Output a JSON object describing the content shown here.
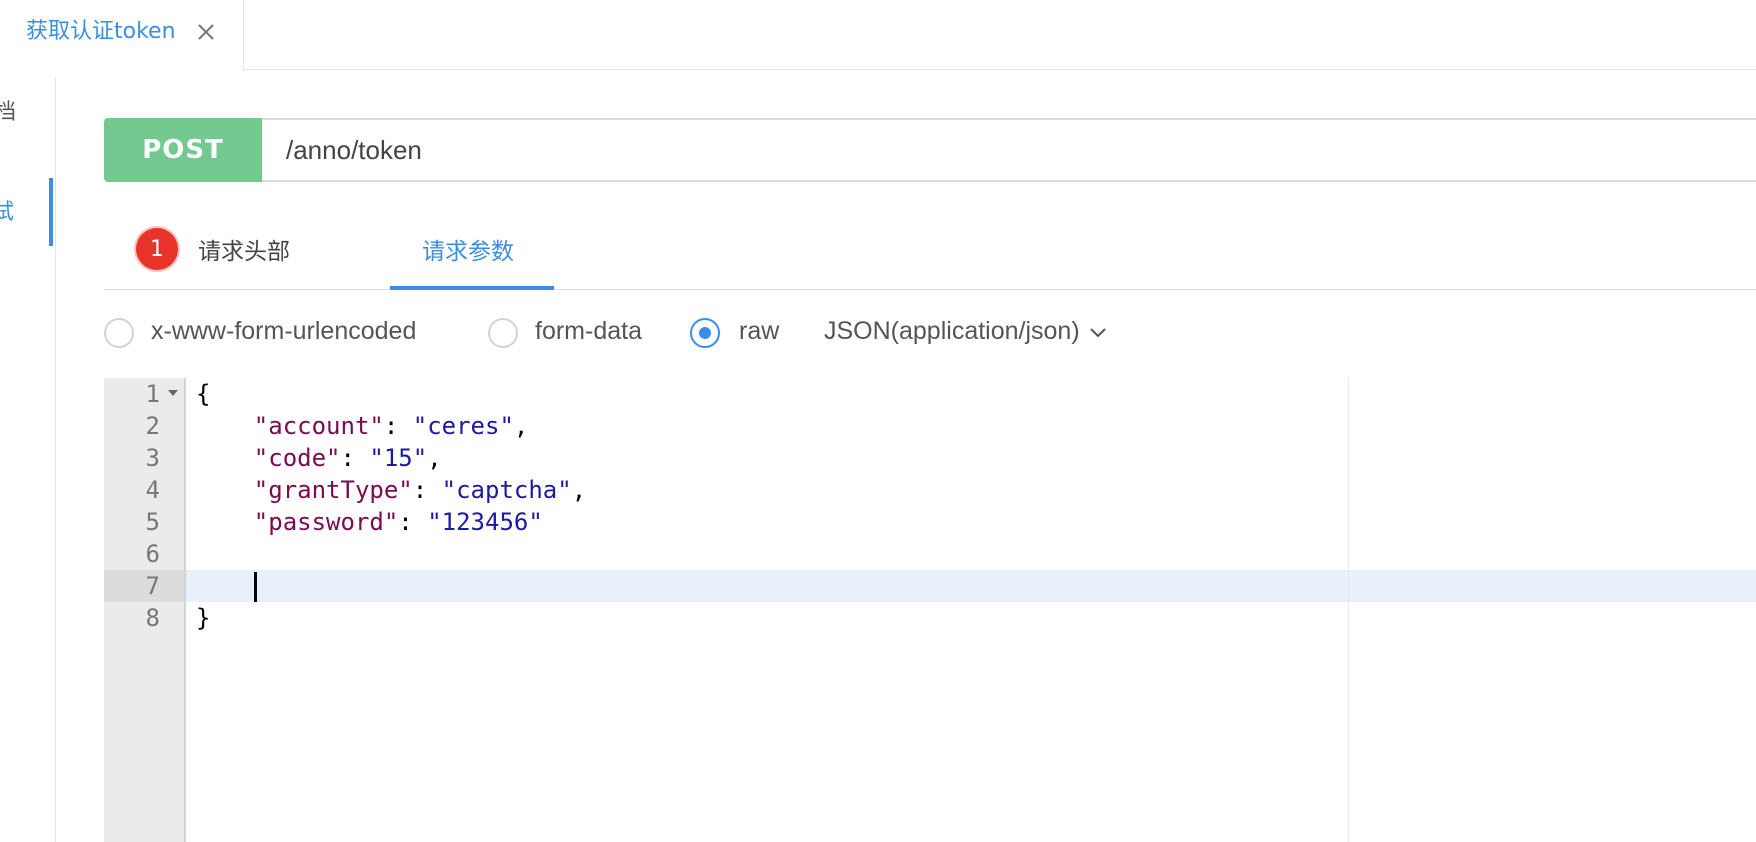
{
  "tab": {
    "label": "获取认证token"
  },
  "sidebar": {
    "item1_partial": "档",
    "item2_partial": "试"
  },
  "request": {
    "method": "POST",
    "url": "/anno/token"
  },
  "tabs": {
    "headers_badge": "1",
    "headers_label": "请求头部",
    "params_label": "请求参数"
  },
  "body_types": {
    "urlencoded": "x-www-form-urlencoded",
    "formdata": "form-data",
    "raw": "raw",
    "content_type": "JSON(application/json)",
    "selected": "raw"
  },
  "editor": {
    "line_numbers": [
      "1",
      "2",
      "3",
      "4",
      "5",
      "6",
      "7",
      "8"
    ],
    "lines": {
      "l1": "{",
      "l2_key": "\"account\"",
      "l2_val": "\"ceres\"",
      "l3_key": "\"code\"",
      "l3_val": "\"15\"",
      "l4_key": "\"grantType\"",
      "l4_val": "\"captcha\"",
      "l5_key": "\"password\"",
      "l5_val": "\"123456\"",
      "l8": "}"
    },
    "active_line": 7
  },
  "colors": {
    "accent": "#3a8ee6",
    "post": "#73c990",
    "badge": "#e8332a"
  }
}
